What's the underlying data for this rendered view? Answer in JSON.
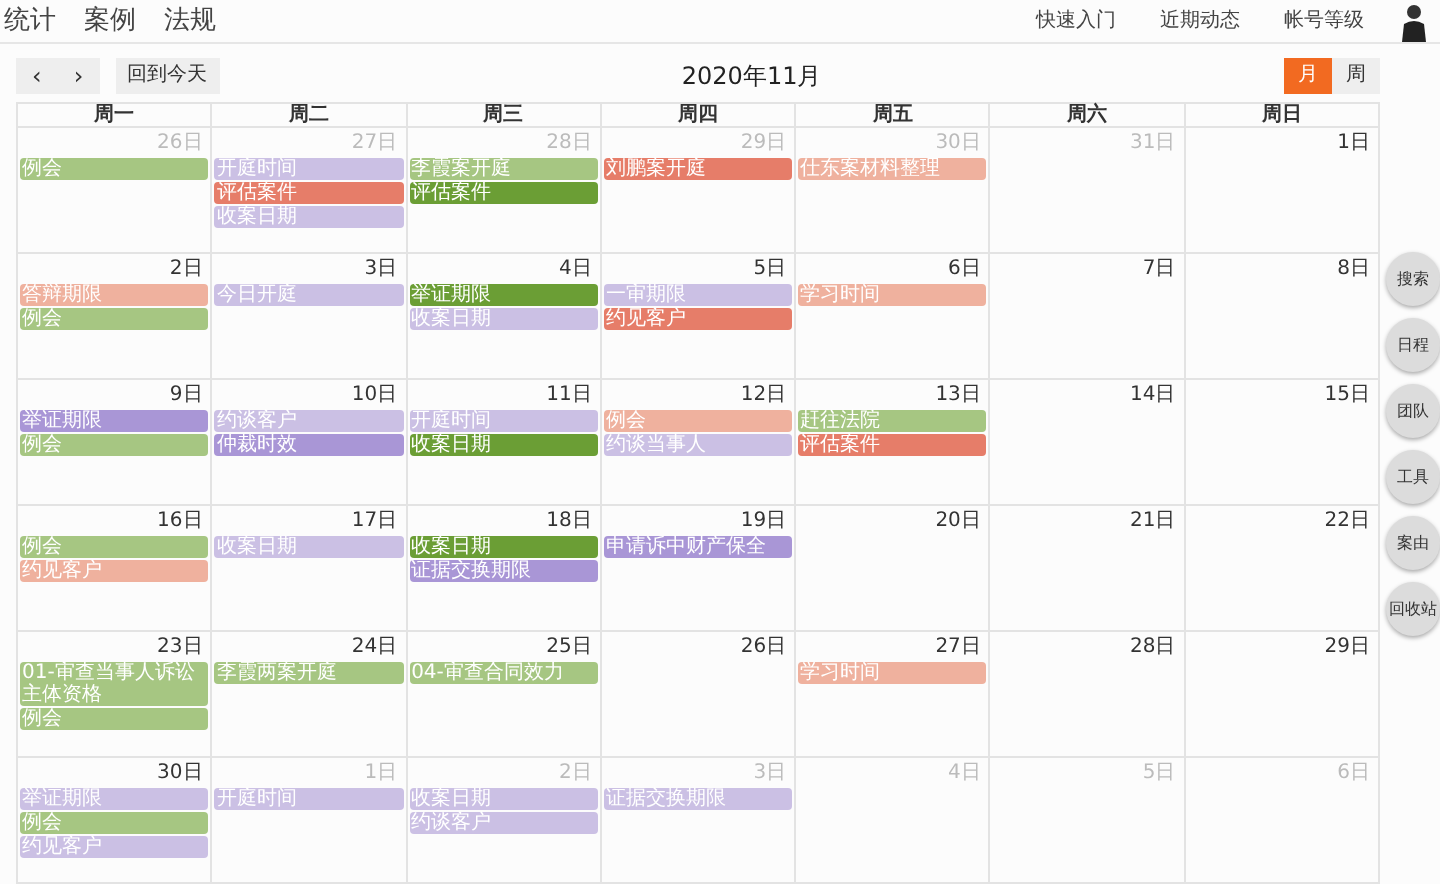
{
  "nav": {
    "items": [
      "统计",
      "案例",
      "法规"
    ],
    "links": [
      "快速入门",
      "近期动态",
      "帐号等级"
    ]
  },
  "toolbar": {
    "prev": "‹",
    "next": "›",
    "today": "回到今天",
    "title": "2020年11月",
    "views": [
      {
        "label": "月",
        "selected": true
      },
      {
        "label": "周",
        "selected": false
      }
    ]
  },
  "weekdays": [
    "周一",
    "周二",
    "周三",
    "周四",
    "周五",
    "周六",
    "周日"
  ],
  "weeks": [
    [
      {
        "date": "26日",
        "other_month": true,
        "events": [
          {
            "title": "例会",
            "color": "#a6c682"
          }
        ]
      },
      {
        "date": "27日",
        "other_month": true,
        "events": [
          {
            "title": "开庭时间",
            "color": "#cbc0e4"
          },
          {
            "title": "评估案件",
            "color": "#e67d69"
          },
          {
            "title": "收案日期",
            "color": "#cbc0e4"
          }
        ]
      },
      {
        "date": "28日",
        "other_month": true,
        "events": [
          {
            "title": "李霞案开庭",
            "color": "#a6c682"
          },
          {
            "title": "评估案件",
            "color": "#6b9e35"
          }
        ]
      },
      {
        "date": "29日",
        "other_month": true,
        "events": [
          {
            "title": "刘鹏案开庭",
            "color": "#e67d69"
          }
        ]
      },
      {
        "date": "30日",
        "other_month": true,
        "events": [
          {
            "title": "仕东案材料整理",
            "color": "#efb19e"
          }
        ]
      },
      {
        "date": "31日",
        "other_month": true
      },
      {
        "date": "1日",
        "other_month": false
      }
    ],
    [
      {
        "date": "2日",
        "other_month": false,
        "events": [
          {
            "title": "答辩期限",
            "color": "#efb19e"
          },
          {
            "title": "例会",
            "color": "#a6c682"
          }
        ]
      },
      {
        "date": "3日",
        "other_month": false,
        "events": [
          {
            "title": "今日开庭",
            "color": "#cbc0e4"
          }
        ]
      },
      {
        "date": "4日",
        "other_month": false,
        "events": [
          {
            "title": "举证期限",
            "color": "#6b9e35"
          },
          {
            "title": "收案日期",
            "color": "#cbc0e4"
          }
        ]
      },
      {
        "date": "5日",
        "other_month": false,
        "events": [
          {
            "title": "一审期限",
            "color": "#cbc0e4"
          },
          {
            "title": "约见客户",
            "color": "#e67d69"
          }
        ]
      },
      {
        "date": "6日",
        "other_month": false,
        "events": [
          {
            "title": "学习时间",
            "color": "#efb19e"
          }
        ]
      },
      {
        "date": "7日",
        "other_month": false
      },
      {
        "date": "8日",
        "other_month": false
      }
    ],
    [
      {
        "date": "9日",
        "other_month": false,
        "events": [
          {
            "title": "举证期限",
            "color": "#a996d6"
          },
          {
            "title": "例会",
            "color": "#a6c682"
          }
        ]
      },
      {
        "date": "10日",
        "other_month": false,
        "events": [
          {
            "title": "约谈客户",
            "color": "#cbc0e4"
          },
          {
            "title": "仲裁时效",
            "color": "#a996d6"
          }
        ]
      },
      {
        "date": "11日",
        "other_month": false,
        "events": [
          {
            "title": "开庭时间",
            "color": "#cbc0e4"
          },
          {
            "title": "收案日期",
            "color": "#6b9e35"
          }
        ]
      },
      {
        "date": "12日",
        "other_month": false,
        "events": [
          {
            "title": "例会",
            "color": "#efb19e"
          },
          {
            "title": "约谈当事人",
            "color": "#cbc0e4"
          }
        ]
      },
      {
        "date": "13日",
        "other_month": false,
        "events": [
          {
            "title": "赶往法院",
            "color": "#a6c682"
          },
          {
            "title": "评估案件",
            "color": "#e67d69"
          }
        ]
      },
      {
        "date": "14日",
        "other_month": false
      },
      {
        "date": "15日",
        "other_month": false
      }
    ],
    [
      {
        "date": "16日",
        "other_month": false,
        "events": [
          {
            "title": "例会",
            "color": "#a6c682"
          },
          {
            "title": "约见客户",
            "color": "#efb19e"
          }
        ]
      },
      {
        "date": "17日",
        "other_month": false,
        "events": [
          {
            "title": "收案日期",
            "color": "#cbc0e4"
          }
        ]
      },
      {
        "date": "18日",
        "other_month": false,
        "events": [
          {
            "title": "收案日期",
            "color": "#6b9e35"
          },
          {
            "title": "证据交换期限",
            "color": "#a996d6"
          }
        ]
      },
      {
        "date": "19日",
        "other_month": false,
        "events": [
          {
            "title": "申请诉中财产保全",
            "color": "#a996d6"
          }
        ]
      },
      {
        "date": "20日",
        "other_month": false
      },
      {
        "date": "21日",
        "other_month": false
      },
      {
        "date": "22日",
        "other_month": false
      }
    ],
    [
      {
        "date": "23日",
        "other_month": false,
        "events": [
          {
            "title": "01-审查当事人诉讼主体资格",
            "color": "#a6c682"
          },
          {
            "title": "例会",
            "color": "#a6c682"
          }
        ]
      },
      {
        "date": "24日",
        "other_month": false,
        "events": [
          {
            "title": "李霞两案开庭",
            "color": "#a6c682"
          }
        ]
      },
      {
        "date": "25日",
        "other_month": false,
        "events": [
          {
            "title": "04-审查合同效力",
            "color": "#a6c682"
          }
        ]
      },
      {
        "date": "26日",
        "other_month": false
      },
      {
        "date": "27日",
        "other_month": false,
        "events": [
          {
            "title": "学习时间",
            "color": "#efb19e"
          }
        ]
      },
      {
        "date": "28日",
        "other_month": false
      },
      {
        "date": "29日",
        "other_month": false
      }
    ],
    [
      {
        "date": "30日",
        "other_month": false,
        "events": [
          {
            "title": "举证期限",
            "color": "#cbc0e4"
          },
          {
            "title": "例会",
            "color": "#a6c682"
          },
          {
            "title": "约见客户",
            "color": "#cbc0e4"
          }
        ]
      },
      {
        "date": "1日",
        "other_month": true,
        "events": [
          {
            "title": "开庭时间",
            "color": "#cbc0e4"
          }
        ]
      },
      {
        "date": "2日",
        "other_month": true,
        "events": [
          {
            "title": "收案日期",
            "color": "#cbc0e4"
          },
          {
            "title": "约谈客户",
            "color": "#cbc0e4"
          }
        ]
      },
      {
        "date": "3日",
        "other_month": true,
        "events": [
          {
            "title": "证据交换期限",
            "color": "#cbc0e4"
          }
        ]
      },
      {
        "date": "4日",
        "other_month": true
      },
      {
        "date": "5日",
        "other_month": true
      },
      {
        "date": "6日",
        "other_month": true
      }
    ]
  ],
  "side_buttons": [
    "搜索",
    "日程",
    "团队",
    "工具",
    "案由",
    "回收站"
  ]
}
